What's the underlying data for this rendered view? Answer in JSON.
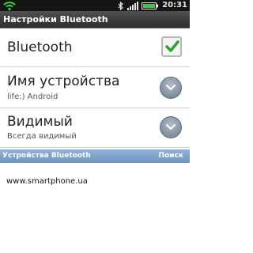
{
  "status_bar": {
    "time": "20:31",
    "icons": [
      "wifi-icon",
      "bluetooth-icon",
      "signal-icon",
      "battery-icon"
    ]
  },
  "title_bar": {
    "title": "Настройки Bluetooth"
  },
  "settings": {
    "bluetooth": {
      "label": "Bluetooth",
      "checked": true
    },
    "device_name": {
      "label": "Имя устройства",
      "value": "life:) Android"
    },
    "visibility": {
      "label": "Видимый",
      "value": "Всегда видимый"
    }
  },
  "devices_section": {
    "title": "Устройства Bluetooth",
    "action": "Поиск"
  },
  "watermark": {
    "text": "www.smartphone.ua"
  },
  "colors": {
    "accent_green": "#2aa52a",
    "section_blue": "#7aa0c8",
    "status_bar": "#151515"
  }
}
